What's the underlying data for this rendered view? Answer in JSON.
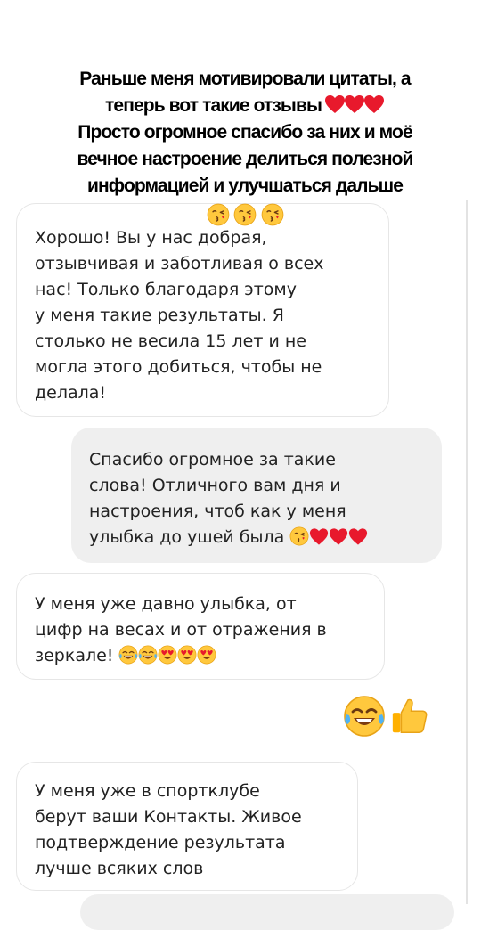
{
  "header": {
    "line1": "Раньше меня мотивировали цитаты, а",
    "line2": "теперь вот такие отзывы",
    "line3": "Просто огромное спасибо за них и моё",
    "line4": "вечное настроение делиться полезной",
    "line5": "информацией и улучшаться дальше",
    "hearts_icon": "red-heart-icon",
    "kiss_icon": "face-blowing-kiss-icon"
  },
  "messages": [
    {
      "direction": "incoming",
      "lines": [
        "Хорошо! Вы у нас добрая,",
        "отзывчивая и заботливая о всех",
        "нас! Только благодаря этому",
        "у меня такие результаты. Я",
        "столько не весила 15 лет и не",
        "могла этого добиться, чтобы не",
        "делала!"
      ]
    },
    {
      "direction": "outgoing",
      "lines": [
        "Спасибо огромное за такие",
        "слова! Отличного вам дня и",
        "настроения, чтоб как у меня",
        "улыбка до ушей была"
      ],
      "trailing_emoji": [
        "face-blowing-kiss-icon",
        "red-heart-icon",
        "red-heart-icon",
        "red-heart-icon"
      ]
    },
    {
      "direction": "incoming",
      "lines": [
        "У меня уже давно улыбка, от",
        "цифр на весах и от отражения в",
        "зеркале!"
      ],
      "trailing_emoji": [
        "tears-of-joy-icon",
        "tears-of-joy-icon",
        "heart-eyes-icon",
        "heart-eyes-icon",
        "heart-eyes-icon"
      ]
    },
    {
      "direction": "incoming",
      "lines": [
        "У меня уже в спортклубе",
        "берут ваши Контакты. Живое",
        "подтверждение  результата",
        "лучше всяких слов"
      ]
    }
  ],
  "reaction": [
    "tears-of-joy-icon",
    "thumbs-up-icon"
  ],
  "colors": {
    "heart": "#e8192c",
    "emoji_face": "#ffc83d",
    "outgoing_bubble": "#efefef",
    "incoming_border": "#e6e6e6"
  }
}
